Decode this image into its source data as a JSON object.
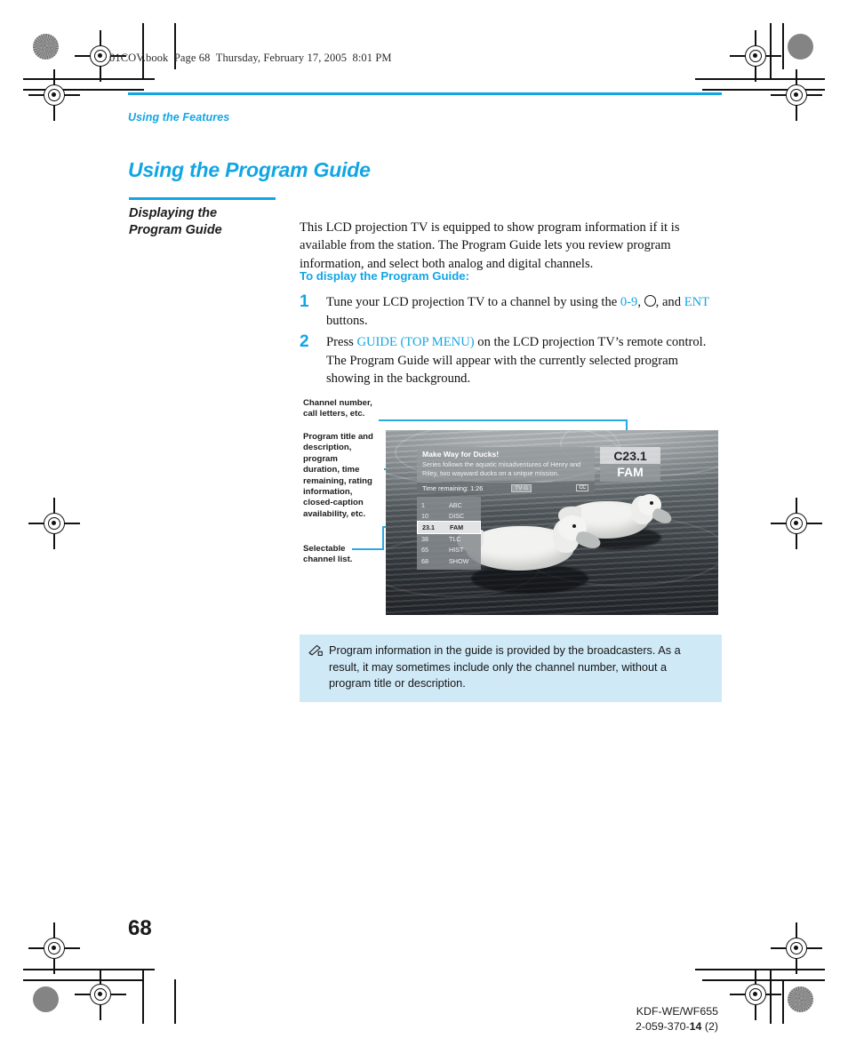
{
  "running_head": "01COV.book  Page 68  Thursday, February 17, 2005  8:01 PM",
  "header": {
    "eyebrow": "Using the Features",
    "title": "Using the Program Guide"
  },
  "section": {
    "heading_line1": "Displaying the",
    "heading_line2": "Program Guide",
    "intro": "This LCD projection TV is equipped to show program information if it is available from the station. The Program Guide lets you review program information, and select both analog and digital channels.",
    "subhead": "To display the Program Guide:"
  },
  "steps": [
    {
      "num": "1",
      "pre": "Tune your LCD projection TV to a channel by using the ",
      "kw1": "0-9",
      "mid": ", ",
      "knob_icon": "channel-knob-icon",
      "mid2": ", and ",
      "kw2": "ENT",
      "post": " buttons."
    },
    {
      "num": "2",
      "pre": "Press ",
      "kw1": "GUIDE (TOP MENU)",
      "post": " on the LCD projection TV’s remote control. The Program Guide will appear with the currently selected program showing in the background."
    }
  ],
  "callouts": [
    {
      "text": "Channel number,\ncall letters, etc."
    },
    {
      "text": "Program title and\ndescription,\nprogram\nduration, time\nremaining, rating\ninformation,\nclosed-caption\navailability, etc."
    },
    {
      "text": "Selectable\nchannel list."
    }
  ],
  "tv_osd": {
    "program_title": "Make Way for Ducks!",
    "program_desc": "Series follows the aquatic misadventures of Henry and Riley, two wayward ducks on a unique mission.",
    "time_remaining": "Time remaining: 1:26",
    "rating": "TV-G",
    "cc_badge": "CC",
    "channel_number": "C23.1",
    "channel_call": "FAM",
    "channel_list": [
      {
        "number": "1",
        "call": "ABC",
        "selected": false
      },
      {
        "number": "10",
        "call": "DISC",
        "selected": false
      },
      {
        "number": "23.1",
        "call": "FAM",
        "selected": true
      },
      {
        "number": "38",
        "call": "TLC",
        "selected": false
      },
      {
        "number": "65",
        "call": "HIST",
        "selected": false
      },
      {
        "number": "68",
        "call": "SHOW",
        "selected": false
      }
    ]
  },
  "note": {
    "icon": "pencil-note-icon",
    "text": "Program information in the guide is provided by the broadcasters. As a result, it may sometimes include only the channel number, without a program title or description."
  },
  "footer": {
    "page_number": "68",
    "model": "KDF-WE/WF655",
    "doc_prefix": "2-059-370-",
    "doc_bold": "14",
    "doc_suffix": " (2)"
  },
  "colors": {
    "accent": "#12a5e4",
    "note_bg": "#cfe9f7",
    "text": "#1a1a1a"
  }
}
